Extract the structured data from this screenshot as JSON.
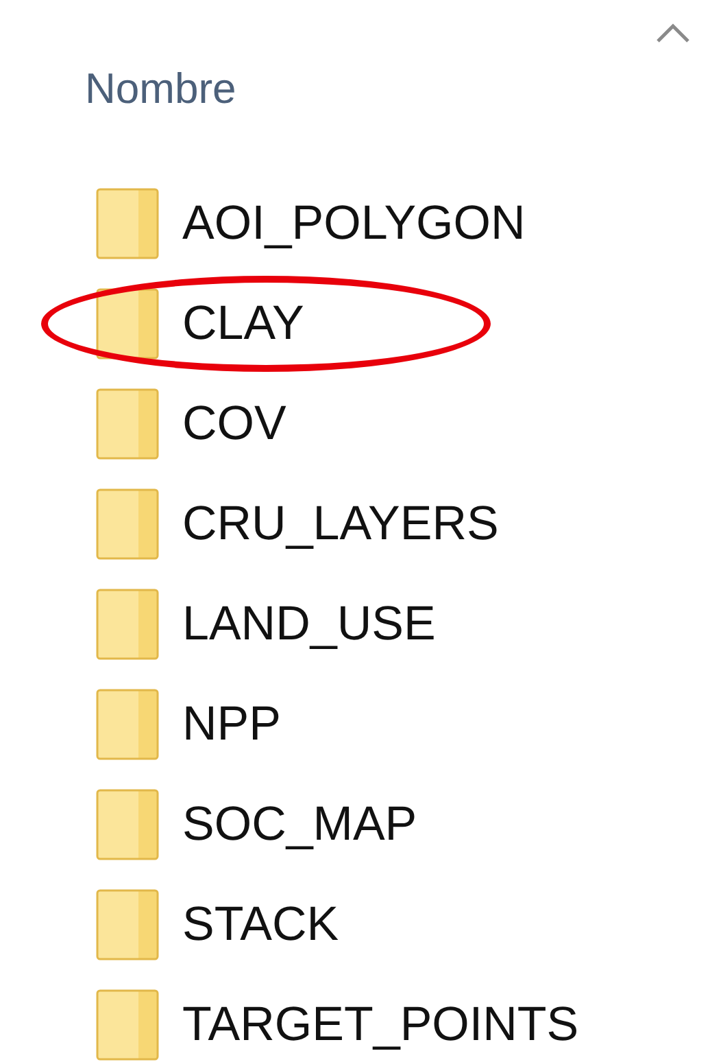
{
  "column_header": {
    "label": "Nombre",
    "sorted": true
  },
  "items": [
    {
      "name": "AOI_POLYGON",
      "circled": false
    },
    {
      "name": "CLAY",
      "circled": true
    },
    {
      "name": "COV",
      "circled": false
    },
    {
      "name": "CRU_LAYERS",
      "circled": false
    },
    {
      "name": "LAND_USE",
      "circled": false
    },
    {
      "name": "NPP",
      "circled": false
    },
    {
      "name": "SOC_MAP",
      "circled": false
    },
    {
      "name": "STACK",
      "circled": false
    },
    {
      "name": "TARGET_POINTS",
      "circled": false
    }
  ]
}
